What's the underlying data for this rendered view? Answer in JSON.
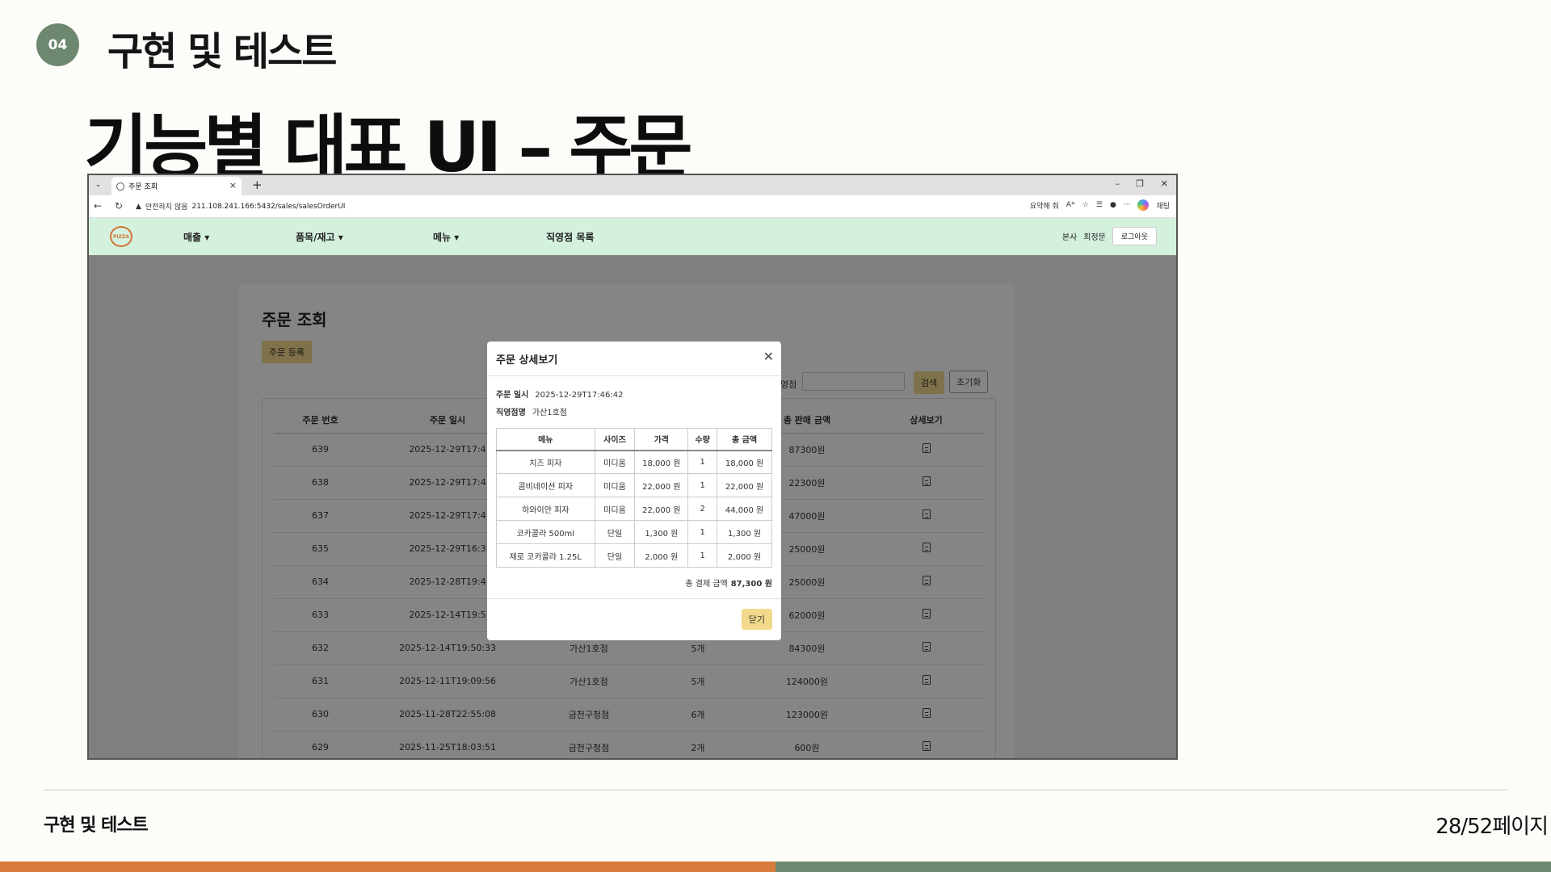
{
  "slide": {
    "section_number": "04",
    "section_title": "구현 및 테스트",
    "main_title": "기능별 대표 UI – 주문",
    "footer_title": "구현 및 테스트",
    "page_label": "28/52페이지",
    "colors": {
      "accent_green": "#6e8870",
      "accent_orange": "#d87c3b"
    }
  },
  "browser": {
    "tab_title": "주문 조회",
    "tab_icon": "globe-icon",
    "security_label": "안전하지 않음",
    "url": "211.108.241.166:5432/sales/salesOrderUI",
    "summary_label": "요약해 줘",
    "copilot_label": "채팅"
  },
  "app": {
    "logo_text": "PIZZA",
    "nav": [
      "매출 ▾",
      "품목/재고 ▾",
      "메뉴 ▾",
      "직영점 목록"
    ],
    "user_role": "본사",
    "user_name": "최정문",
    "logout_label": "로그아웃",
    "nav_color": "#d4f1de"
  },
  "page": {
    "title": "주문 조회",
    "register_label": "주문 등록",
    "filter_label": "영점",
    "search_label": "검색",
    "reset_label": "초기화",
    "columns": [
      "주문 번호",
      "주문 일시",
      "",
      "",
      "총 판매 금액",
      "상세보기"
    ],
    "rows": [
      [
        "639",
        "2025-12-29T17:4",
        "",
        "",
        "87300원"
      ],
      [
        "638",
        "2025-12-29T17:4",
        "",
        "",
        "22300원"
      ],
      [
        "637",
        "2025-12-29T17:4",
        "",
        "",
        "47000원"
      ],
      [
        "635",
        "2025-12-29T16:3",
        "",
        "",
        "25000원"
      ],
      [
        "634",
        "2025-12-28T19:4",
        "",
        "",
        "25000원"
      ],
      [
        "633",
        "2025-12-14T19:5",
        "",
        "",
        "62000원"
      ],
      [
        "632",
        "2025-12-14T19:50:33",
        "가산1호점",
        "5개",
        "84300원"
      ],
      [
        "631",
        "2025-12-11T19:09:56",
        "가산1호점",
        "5개",
        "124000원"
      ],
      [
        "630",
        "2025-11-28T22:55:08",
        "금천구청점",
        "6개",
        "123000원"
      ],
      [
        "629",
        "2025-11-25T18:03:51",
        "금천구청점",
        "2개",
        "600원"
      ]
    ]
  },
  "modal": {
    "title": "주문 상세보기",
    "order_time_label": "주문 일시",
    "order_time": "2025-12-29T17:46:42",
    "store_label": "직영점명",
    "store": "가산1호점",
    "columns": [
      "메뉴",
      "사이즈",
      "가격",
      "수량",
      "총 금액"
    ],
    "items": [
      [
        "치즈 피자",
        "미디움",
        "18,000 원",
        "1",
        "18,000 원"
      ],
      [
        "콤비네이션 피자",
        "미디움",
        "22,000 원",
        "1",
        "22,000 원"
      ],
      [
        "하와이안 피자",
        "미디움",
        "22,000 원",
        "2",
        "44,000 원"
      ],
      [
        "코카콜라 500ml",
        "단일",
        "1,300 원",
        "1",
        "1,300 원"
      ],
      [
        "제로 코카콜라 1.25L",
        "단일",
        "2,000 원",
        "1",
        "2,000 원"
      ]
    ],
    "total_label": "총 결제 금액",
    "total_value": "87,300 원",
    "close_label": "닫기"
  }
}
